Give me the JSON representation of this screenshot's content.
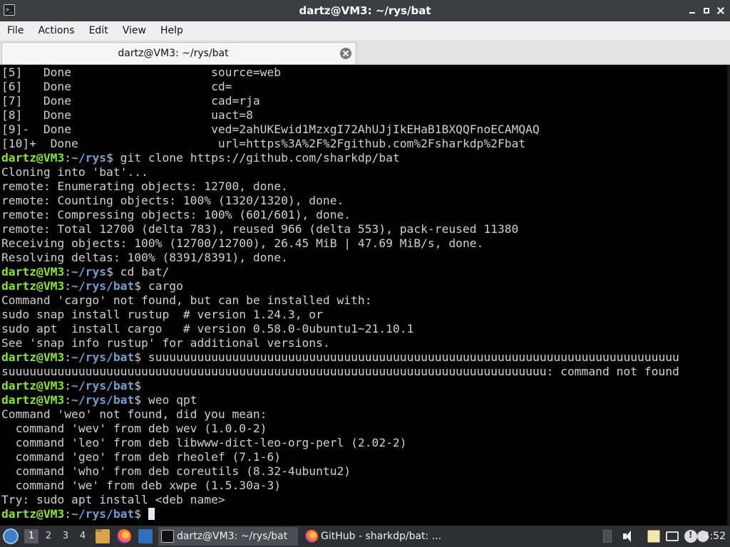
{
  "window": {
    "title": "dartz@VM3: ~/rys/bat",
    "icon": "terminal-icon"
  },
  "menu": [
    "File",
    "Actions",
    "Edit",
    "View",
    "Help"
  ],
  "tab": {
    "label": "dartz@VM3: ~/rys/bat",
    "close_icon": "close-circle-icon"
  },
  "colors": {
    "prompt_user": "#8ae234",
    "prompt_path": "#729fcf",
    "output_text": "#d0d0d0",
    "background": "#000000"
  },
  "terminal": {
    "lines": [
      {
        "text": "[5]   Done                    source=web"
      },
      {
        "text": "[6]   Done                    cd="
      },
      {
        "text": "[7]   Done                    cad=rja"
      },
      {
        "text": "[8]   Done                    uact=8"
      },
      {
        "text": "[9]-  Done                    ved=2ahUKEwid1MzxgI72AhUJjIkEHaB1BXQQFnoECAMQAQ"
      },
      {
        "text": "[10]+  Done                    url=https%3A%2F%2Fgithub.com%2Fsharkdp%2Fbat"
      },
      {
        "user": "dartz@VM3",
        "path": "~/rys",
        "cmd": " git clone https://github.com/sharkdp/bat"
      },
      {
        "text": "Cloning into 'bat'..."
      },
      {
        "text": "remote: Enumerating objects: 12700, done."
      },
      {
        "text": "remote: Counting objects: 100% (1320/1320), done."
      },
      {
        "text": "remote: Compressing objects: 100% (601/601), done."
      },
      {
        "text": "remote: Total 12700 (delta 783), reused 966 (delta 553), pack-reused 11380"
      },
      {
        "text": "Receiving objects: 100% (12700/12700), 26.45 MiB | 47.69 MiB/s, done."
      },
      {
        "text": "Resolving deltas: 100% (8391/8391), done."
      },
      {
        "user": "dartz@VM3",
        "path": "~/rys",
        "cmd": " cd bat/"
      },
      {
        "user": "dartz@VM3",
        "path": "~/rys/bat",
        "cmd": " cargo"
      },
      {
        "text": "Command 'cargo' not found, but can be installed with:"
      },
      {
        "text": "sudo snap install rustup  # version 1.24.3, or"
      },
      {
        "text": "sudo apt  install cargo   # version 0.58.0-0ubuntu1~21.10.1"
      },
      {
        "text": "See 'snap info rustup' for additional versions."
      },
      {
        "user": "dartz@VM3",
        "path": "~/rys/bat",
        "cmd": " suuuuuuuuuuuuuuuuuuuuuuuuuuuuuuuuuuuuuuuuuuuuuuuuuuuuuuuuuuuuuuuuuuuuuuuuuuu"
      },
      {
        "text": "suuuuuuuuuuuuuuuuuuuuuuuuuuuuuuuuuuuuuuuuuuuuuuuuuuuuuuuuuuuuuuuuuuuuuuuuuuuuu: command not found"
      },
      {
        "user": "dartz@VM3",
        "path": "~/rys/bat",
        "cmd": ""
      },
      {
        "user": "dartz@VM3",
        "path": "~/rys/bat",
        "cmd": " weo qpt"
      },
      {
        "text": "Command 'weo' not found, did you mean:"
      },
      {
        "text": "  command 'wev' from deb wev (1.0.0-2)"
      },
      {
        "text": "  command 'leo' from deb libwww-dict-leo-org-perl (2.02-2)"
      },
      {
        "text": "  command 'geo' from deb rheolef (7.1-6)"
      },
      {
        "text": "  command 'who' from deb coreutils (8.32-4ubuntu2)"
      },
      {
        "text": "  command 'we' from deb xwpe (1.5.30a-3)"
      },
      {
        "text": "Try: sudo apt install <deb name>"
      },
      {
        "user": "dartz@VM3",
        "path": "~/rys/bat",
        "cmd": " ",
        "cursor": true
      }
    ]
  },
  "taskbar": {
    "start_icon": "lxqt-start-icon",
    "desktops": [
      "1",
      "2",
      "3",
      "4"
    ],
    "active_desktop": "1",
    "quicklaunch": [
      "file-manager-icon",
      "firefox-icon",
      "show-desktop-icon"
    ],
    "tasks": [
      {
        "label": "dartz@VM3: ~/rys/bat",
        "icon": "terminal-icon",
        "active": true
      },
      {
        "label": "GitHub - sharkdp/bat: ...",
        "icon": "firefox-icon",
        "active": false
      }
    ],
    "tray": [
      "scroll-icon",
      "volume-icon",
      "clipboard-icon",
      "monitor-icon",
      "network-alert-icon",
      "user-icon"
    ],
    "clock": "4:52"
  }
}
